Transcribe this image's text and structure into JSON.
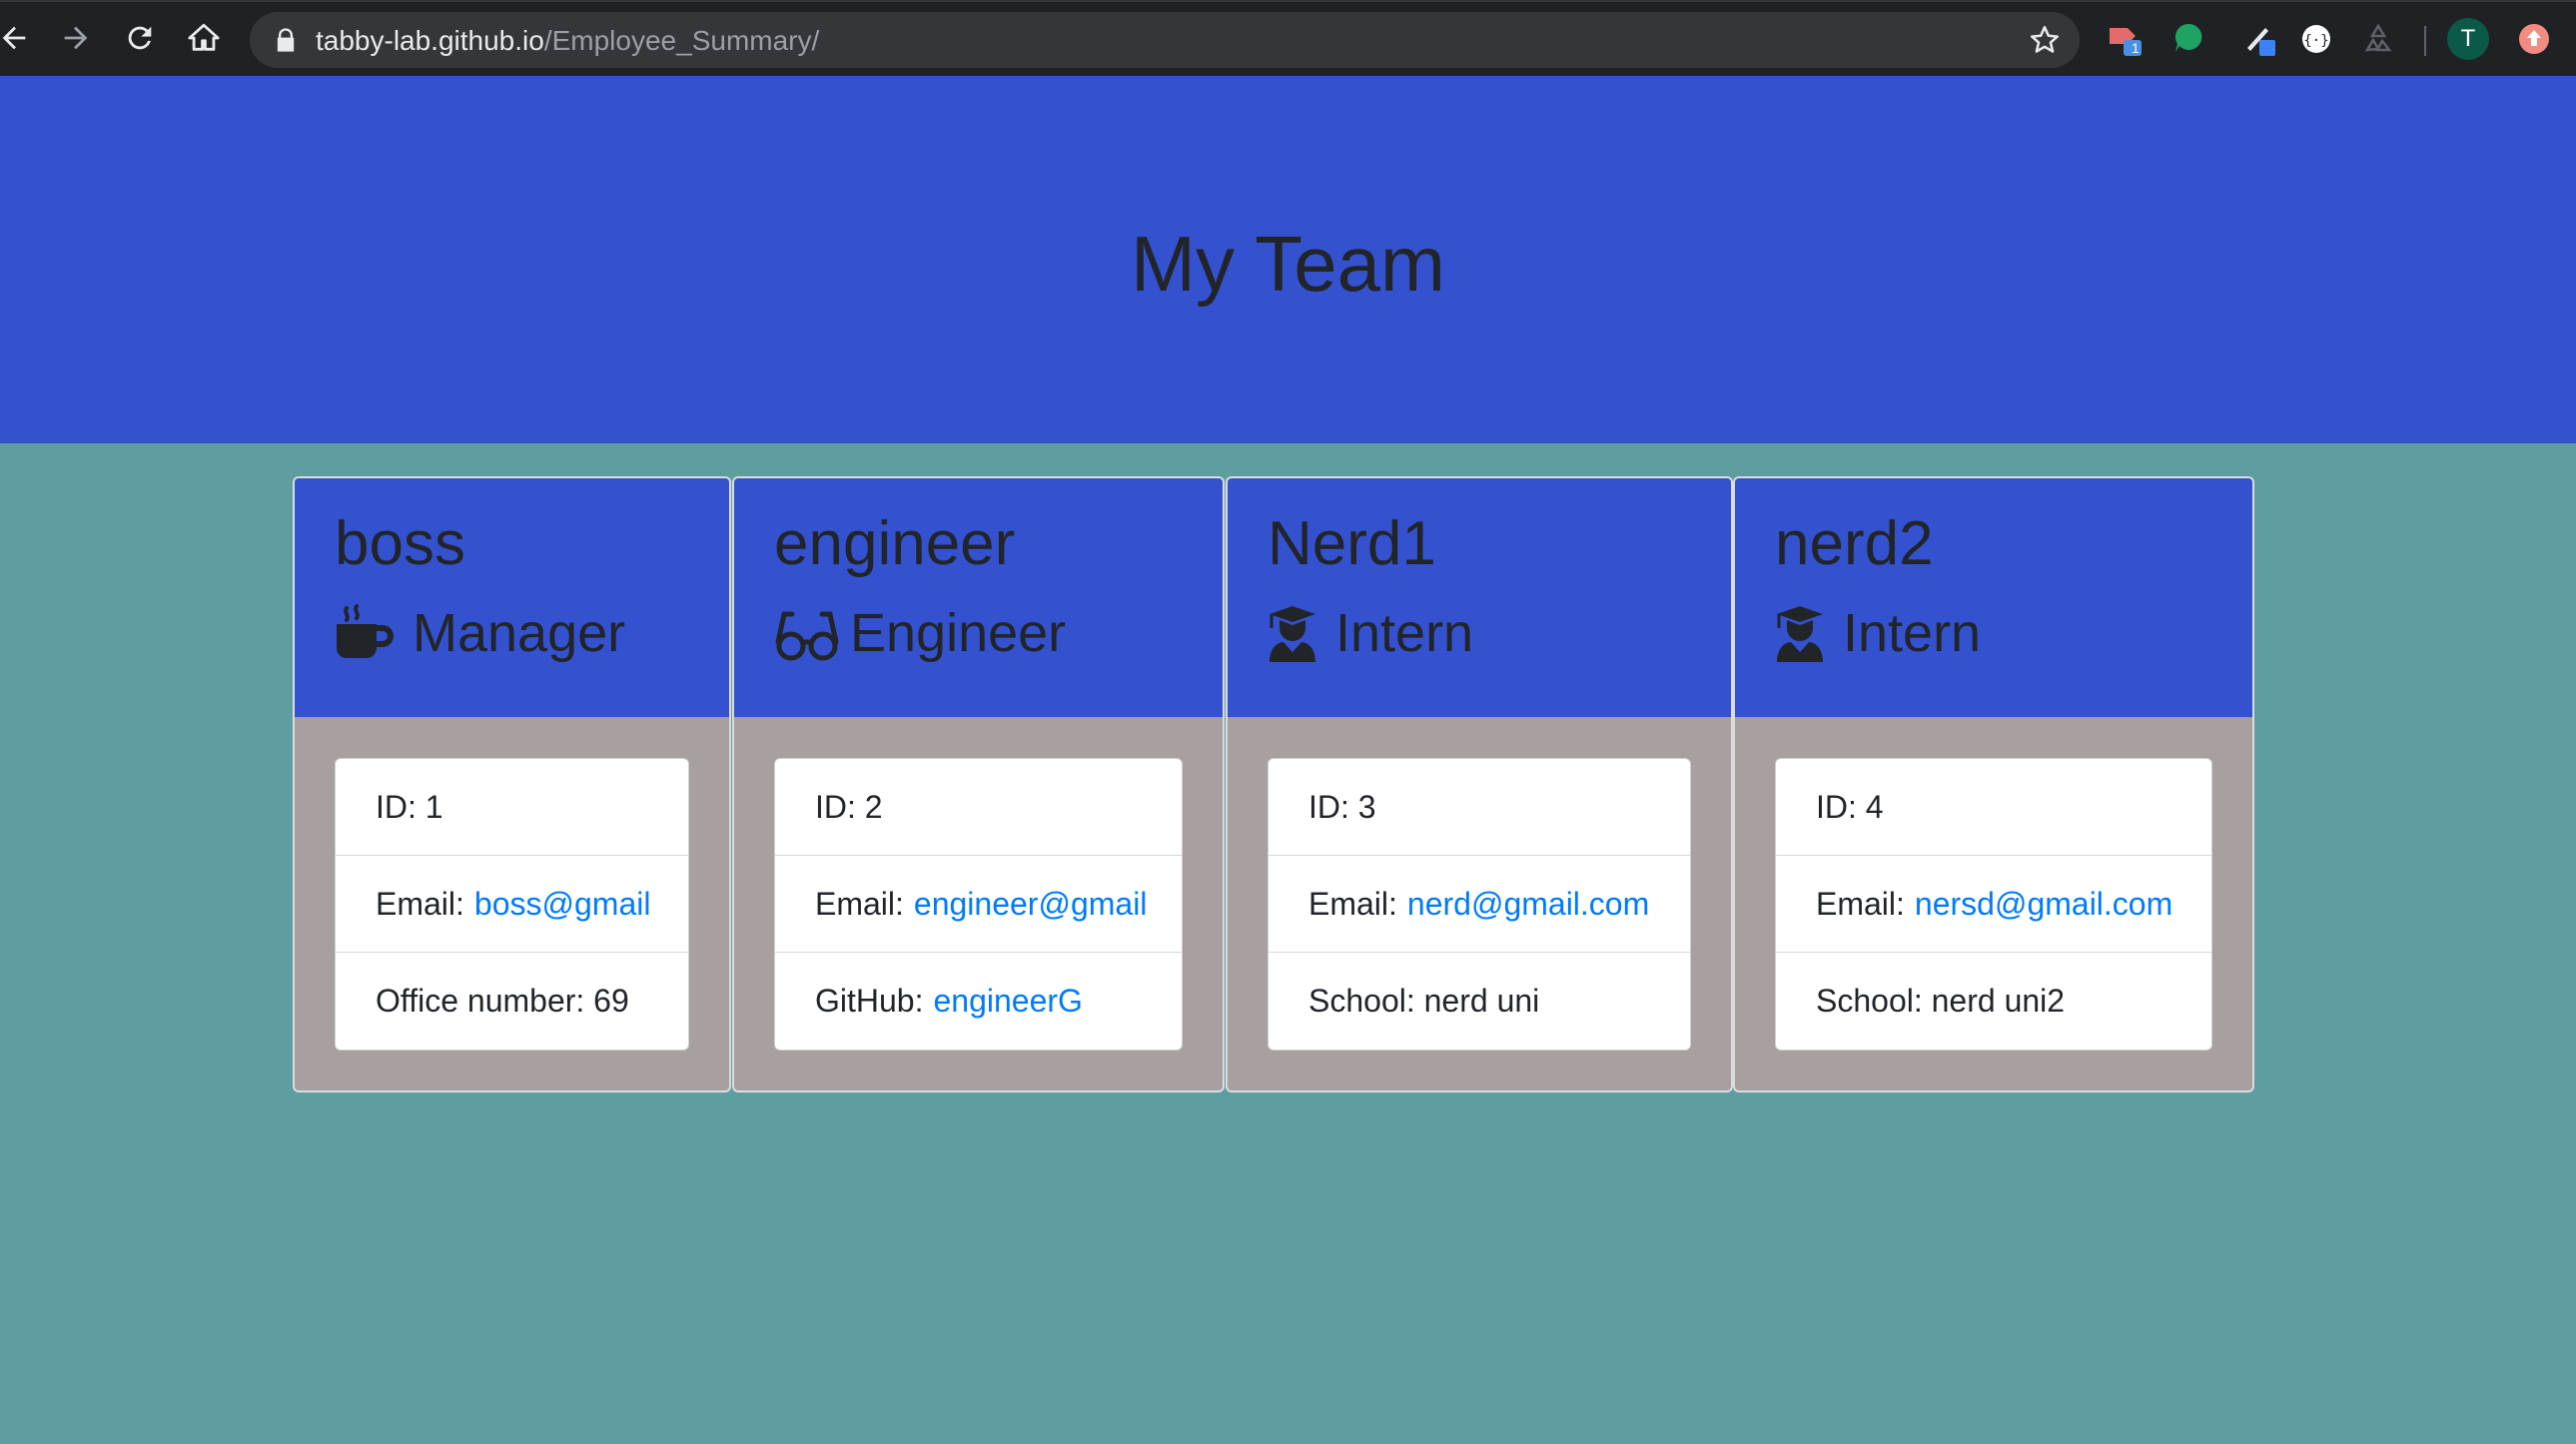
{
  "browser": {
    "url_host": "tabby-lab.github.io",
    "url_path": "/Employee_Summary/",
    "extension_badge": "1",
    "avatar_letter": "T"
  },
  "header": {
    "title": "My Team"
  },
  "cards": [
    {
      "name": "boss",
      "role": "Manager",
      "role_icon": "coffee-icon",
      "id_text": "ID: 1",
      "email_label": "Email:",
      "email": "boss@gmail",
      "extra_label": "Office number: 69",
      "extra_link": ""
    },
    {
      "name": "engineer",
      "role": "Engineer",
      "role_icon": "glasses-icon",
      "id_text": "ID: 2",
      "email_label": "Email:",
      "email": "engineer@gmail",
      "extra_label": "GitHub:",
      "extra_link": "engineerG"
    },
    {
      "name": "Nerd1",
      "role": "Intern",
      "role_icon": "graduate-icon",
      "id_text": "ID: 3",
      "email_label": "Email:",
      "email": "nerd@gmail.com",
      "extra_label": "School: nerd uni",
      "extra_link": ""
    },
    {
      "name": "nerd2",
      "role": "Intern",
      "role_icon": "graduate-icon",
      "id_text": "ID: 4",
      "email_label": "Email:",
      "email": "nersd@gmail.com",
      "extra_label": "School: nerd uni2",
      "extra_link": ""
    }
  ],
  "colors": {
    "page_bg": "#5f9ea0",
    "header_bg": "#3452cf",
    "card_body_bg": "#a8a0a0",
    "link": "#007bff"
  }
}
